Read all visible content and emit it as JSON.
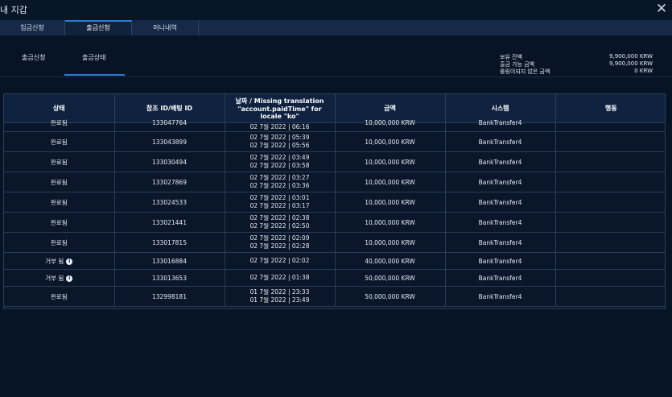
{
  "window": {
    "title": "내 지갑"
  },
  "tabs": [
    {
      "label": "입금신청"
    },
    {
      "label": "출금신청"
    },
    {
      "label": "머니내역"
    }
  ],
  "subtabs": [
    {
      "label": "출금신청"
    },
    {
      "label": "출금상태"
    }
  ],
  "balance": {
    "held_label": "보유 잔액",
    "held_value": "9,900,000 KRW",
    "available_label": "출금 가능 금액",
    "available_value": "9,900,000 KRW",
    "rollover_label": "롤링이되지 않은 금액",
    "rollover_value": "0 KRW"
  },
  "table": {
    "headers": [
      "상태",
      "참조 ID/배팅 ID",
      "날짜 / Missing translation \"account.paidTime\" for locale \"ko\"",
      "금액",
      "시스템",
      "행동"
    ],
    "partial_row": {
      "status": "완료됨",
      "ref": "133047764",
      "date": "02 7월 2022 | 06:16",
      "amount": "10,000,000 KRW",
      "system": "BankTransfer4"
    },
    "rows": [
      {
        "status": "완료됨",
        "info": false,
        "ref": "133043899",
        "date1": "02 7월 2022 | 05:39",
        "date2": "02 7월 2022 | 05:56",
        "amount": "10,000,000 KRW",
        "system": "BankTransfer4"
      },
      {
        "status": "완료됨",
        "info": false,
        "ref": "133030494",
        "date1": "02 7월 2022 | 03:49",
        "date2": "02 7월 2022 | 03:58",
        "amount": "10,000,000 KRW",
        "system": "BankTransfer4"
      },
      {
        "status": "완료됨",
        "info": false,
        "ref": "133027869",
        "date1": "02 7월 2022 | 03:27",
        "date2": "02 7월 2022 | 03:36",
        "amount": "10,000,000 KRW",
        "system": "BankTransfer4"
      },
      {
        "status": "완료됨",
        "info": false,
        "ref": "133024533",
        "date1": "02 7월 2022 | 03:01",
        "date2": "02 7월 2022 | 03:17",
        "amount": "10,000,000 KRW",
        "system": "BankTransfer4"
      },
      {
        "status": "완료됨",
        "info": false,
        "ref": "133021441",
        "date1": "02 7월 2022 | 02:38",
        "date2": "02 7월 2022 | 02:50",
        "amount": "10,000,000 KRW",
        "system": "BankTransfer4"
      },
      {
        "status": "완료됨",
        "info": false,
        "ref": "133017815",
        "date1": "02 7월 2022 | 02:09",
        "date2": "02 7월 2022 | 02:28",
        "amount": "10,000,000 KRW",
        "system": "BankTransfer4"
      },
      {
        "status": "거부 됨",
        "info": true,
        "ref": "133016884",
        "date1": "02 7월 2022 | 02:02",
        "date2": "",
        "amount": "40,000,000 KRW",
        "system": "BankTransfer4"
      },
      {
        "status": "거부 됨",
        "info": true,
        "ref": "133013653",
        "date1": "02 7월 2022 | 01:38",
        "date2": "",
        "amount": "50,000,000 KRW",
        "system": "BankTransfer4"
      },
      {
        "status": "완료됨",
        "info": false,
        "ref": "132998181",
        "date1": "01 7월 2022 | 23:33",
        "date2": "01 7월 2022 | 23:49",
        "amount": "50,000,000 KRW",
        "system": "BankTransfer4"
      }
    ]
  },
  "icons": {
    "close": "close-icon",
    "info": "info-icon"
  }
}
